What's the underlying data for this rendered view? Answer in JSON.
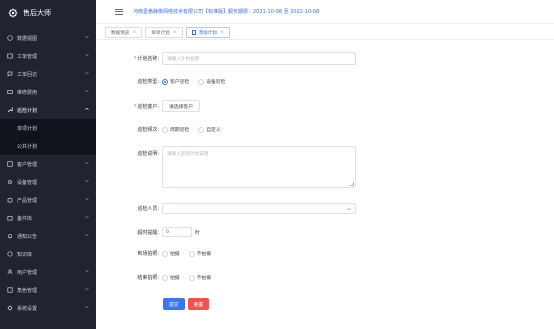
{
  "app": {
    "name": "售后大师"
  },
  "header": {
    "title": "河南壹格静像网络技术有限公司【标准版】服务期限：2021-10-08 至 2022-10-08"
  },
  "sidebar": {
    "items": [
      {
        "label": "数据视图",
        "icon": "monitor-icon"
      },
      {
        "label": "工单管理",
        "icon": "ticket-icon"
      },
      {
        "label": "工单回访",
        "icon": "chat-icon"
      },
      {
        "label": "维修费用",
        "icon": "money-icon"
      },
      {
        "label": "巡检计划",
        "icon": "wrench-icon",
        "expanded": true
      },
      {
        "label": "客户管理",
        "icon": "customer-icon"
      },
      {
        "label": "设备管理",
        "icon": "gear-icon"
      },
      {
        "label": "产品管理",
        "icon": "product-icon"
      },
      {
        "label": "备件库",
        "icon": "box-icon"
      },
      {
        "label": "通知公告",
        "icon": "bell-icon"
      },
      {
        "label": "知识库",
        "icon": "book-icon"
      },
      {
        "label": "用户管理",
        "icon": "user-icon"
      },
      {
        "label": "角色管理",
        "icon": "role-icon"
      },
      {
        "label": "系统设置",
        "icon": "settings-icon"
      }
    ],
    "submenu": [
      "单项计划",
      "公共计划"
    ]
  },
  "tabs": [
    {
      "label": "数据预览",
      "close": "×"
    },
    {
      "label": "单项计划",
      "close": "×"
    },
    {
      "label": "添加计划",
      "close": "×",
      "active": true
    }
  ],
  "form": {
    "plan_name": {
      "label": "计划名称:",
      "placeholder": "请输入计划名称"
    },
    "inspect_type": {
      "label": "巡检类型:",
      "options": [
        "客户巡检",
        "设备巡检"
      ],
      "selected": "客户巡检"
    },
    "customer": {
      "label": "巡检客户:",
      "button": "请选择客户"
    },
    "frequency": {
      "label": "巡检频次:",
      "options": [
        "周期巡检",
        "自定义"
      ]
    },
    "description": {
      "label": "巡检说明:",
      "placeholder": "请输入巡检计划说明"
    },
    "inspector": {
      "label": "巡检人员:"
    },
    "timeout": {
      "label": "超时提醒:",
      "value": "0",
      "unit": "时"
    },
    "sign_in": {
      "label": "到场拍照:",
      "options": [
        "拍摄",
        "不拍摄"
      ]
    },
    "finish_photo": {
      "label": "结束拍照:",
      "options": [
        "拍摄",
        "不拍摄"
      ]
    },
    "submit": "提交",
    "reset": "重置"
  },
  "colors": {
    "sidebar_bg": "#1f2430",
    "submenu_bg": "#0f131b",
    "accent": "#3a74f0",
    "danger": "#f05151",
    "title": "#3f6fd6"
  }
}
